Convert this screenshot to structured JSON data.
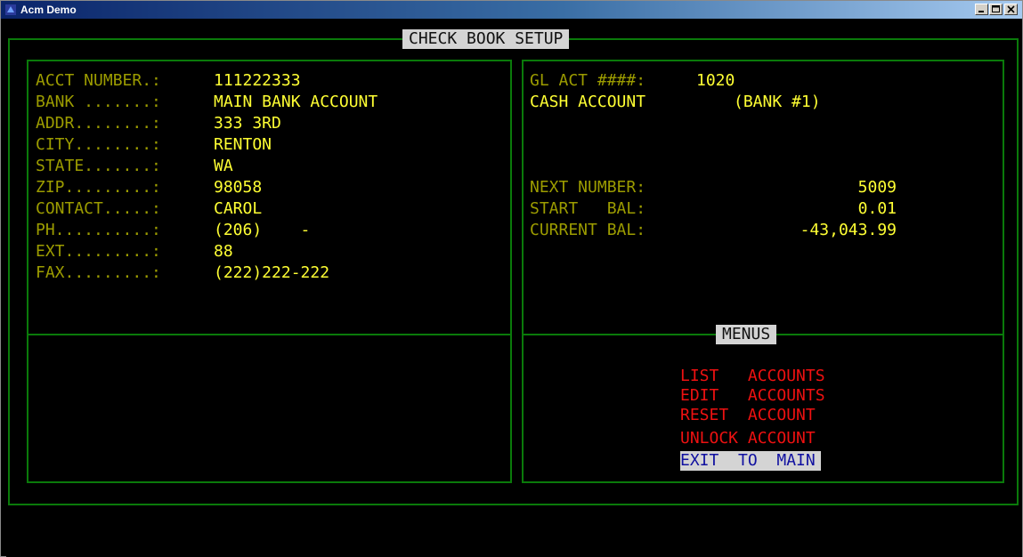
{
  "window": {
    "title": "Acm Demo",
    "controls": [
      "minimize",
      "maximize",
      "close"
    ]
  },
  "screen_title": "CHECK BOOK SETUP",
  "bank_info": {
    "fields": [
      {
        "label": "ACCT NUMBER.:",
        "value": "111222333"
      },
      {
        "label": "BANK .......:",
        "value": "MAIN BANK ACCOUNT"
      },
      {
        "label": "ADDR........:",
        "value": "333 3RD"
      },
      {
        "label": "CITY........:",
        "value": "RENTON"
      },
      {
        "label": "STATE.......:",
        "value": "WA"
      },
      {
        "label": "ZIP.........:",
        "value": "98058"
      },
      {
        "label": "CONTACT.....:",
        "value": "CAROL"
      },
      {
        "label": "PH..........:",
        "value": "(206)    -"
      },
      {
        "label": "EXT.........:",
        "value": "88"
      },
      {
        "label": "FAX.........:",
        "value": "(222)222-222"
      }
    ]
  },
  "gl_info": {
    "gl_label": "GL ACT ####:",
    "gl_value": "1020",
    "cash_label": "CASH ACCOUNT",
    "cash_value": "(BANK #1)",
    "balances": [
      {
        "label": "NEXT NUMBER:",
        "value": "5009"
      },
      {
        "label": "START   BAL:",
        "value": "0.01"
      },
      {
        "label": "CURRENT BAL:",
        "value": "-43,043.99"
      }
    ]
  },
  "menus": {
    "title": "MENUS",
    "items": [
      {
        "label": "LIST   ACCOUNTS",
        "selected": false
      },
      {
        "label": "EDIT   ACCOUNTS",
        "selected": false
      },
      {
        "label": "RESET  ACCOUNT",
        "selected": false
      },
      {
        "label": "UNLOCK ACCOUNT",
        "selected": false
      },
      {
        "label": "EXIT  TO  MAIN",
        "selected": true
      }
    ]
  },
  "colors": {
    "border": "#0a7a0a",
    "label": "#9c9c00",
    "value": "#ffff33",
    "menu_item": "#ee1111",
    "menu_selected_text": "#1010a0",
    "menu_selected_bg": "#d4d4d4"
  }
}
